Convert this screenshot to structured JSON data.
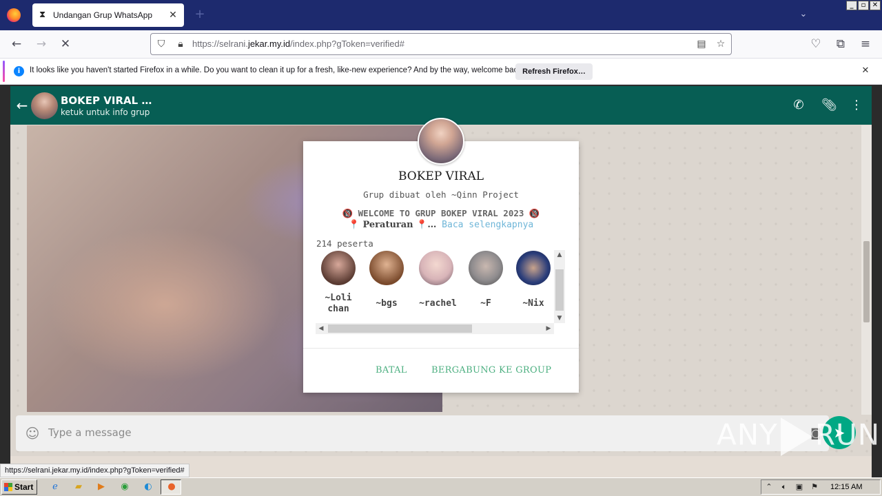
{
  "browser": {
    "tab_title": "Undangan Grup WhatsApp",
    "url_prefix": "https://selrani.",
    "url_domain": "jekar.my.id",
    "url_suffix": "/index.php?gToken=verified#",
    "notification_text": "It looks like you haven't started Firefox in a while. Do you want to clean it up for a fresh, like-new experience? And by the way, welcome back!",
    "notification_button": "Refresh Firefox…",
    "status_url": "https://selrani.jekar.my.id/index.php?gToken=verified#"
  },
  "whatsapp": {
    "group_name": "BOKEP VIRAL …",
    "group_subtitle": "ketuk untuk info grup",
    "message_placeholder": "Type a message"
  },
  "modal": {
    "title": "BOKEP VIRAL",
    "created_by": "Grup dibuat oleh ~Qinn Project",
    "description_line1": "🔞 WELCOME TO GRUP BOKEP VIRAL 2023 🔞",
    "description_rules": "📍 Peraturan 📍…",
    "read_more": "Baca selengkapnya",
    "participant_count": "214 peserta",
    "members": [
      {
        "name": "~Loli chan",
        "color": "#5a3b32"
      },
      {
        "name": "~bgs",
        "color": "#7a4a2c"
      },
      {
        "name": "~rachel",
        "color": "#d8b4b8"
      },
      {
        "name": "~F",
        "color": "#8f8c8e"
      },
      {
        "name": "~Nix",
        "color": "#2a3d7a"
      }
    ],
    "cancel_label": "BATAL",
    "join_label": "BERGABUNG KE GROUP"
  },
  "watermark": {
    "left": "ANY",
    "right": "RUN"
  },
  "taskbar": {
    "start_label": "Start",
    "clock": "12:15 AM"
  },
  "colors": {
    "whatsapp_header": "#075e54",
    "accent_green": "#4caf80",
    "link_blue": "#6fb6d8",
    "firefox_tabstrip": "#1d2a6e"
  }
}
